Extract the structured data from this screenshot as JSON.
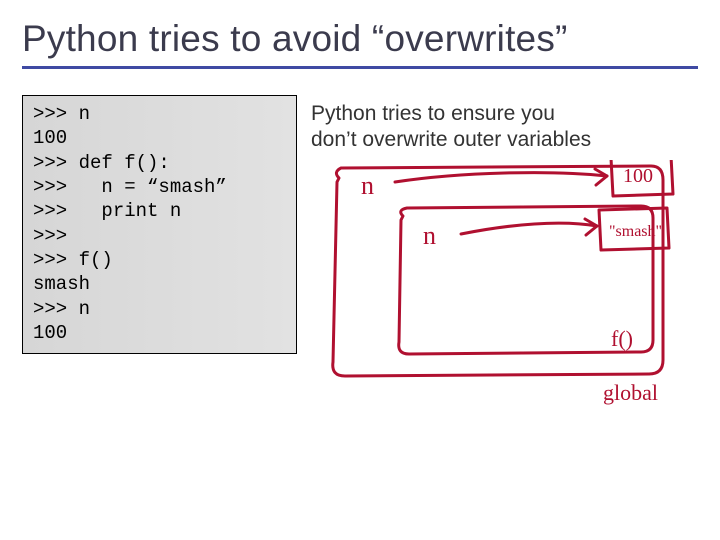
{
  "title": "Python tries to avoid “overwrites”",
  "caption_line1": "Python tries to ensure you",
  "caption_line2": "don’t overwrite outer variables",
  "code": {
    "l1": ">>> n",
    "l2": "100",
    "l3": ">>> def f():",
    "l4": ">>>   n = “smash”",
    "l5": ">>>   print n",
    "l6": ">>>",
    "l7": ">>> f()",
    "l8": "smash",
    "l9": ">>> n",
    "l10": "100"
  },
  "diagram": {
    "outer_var": "n",
    "outer_val": "100",
    "inner_var": "n",
    "inner_val": "\"smash\"",
    "inner_label": "f()",
    "outer_label": "global"
  }
}
